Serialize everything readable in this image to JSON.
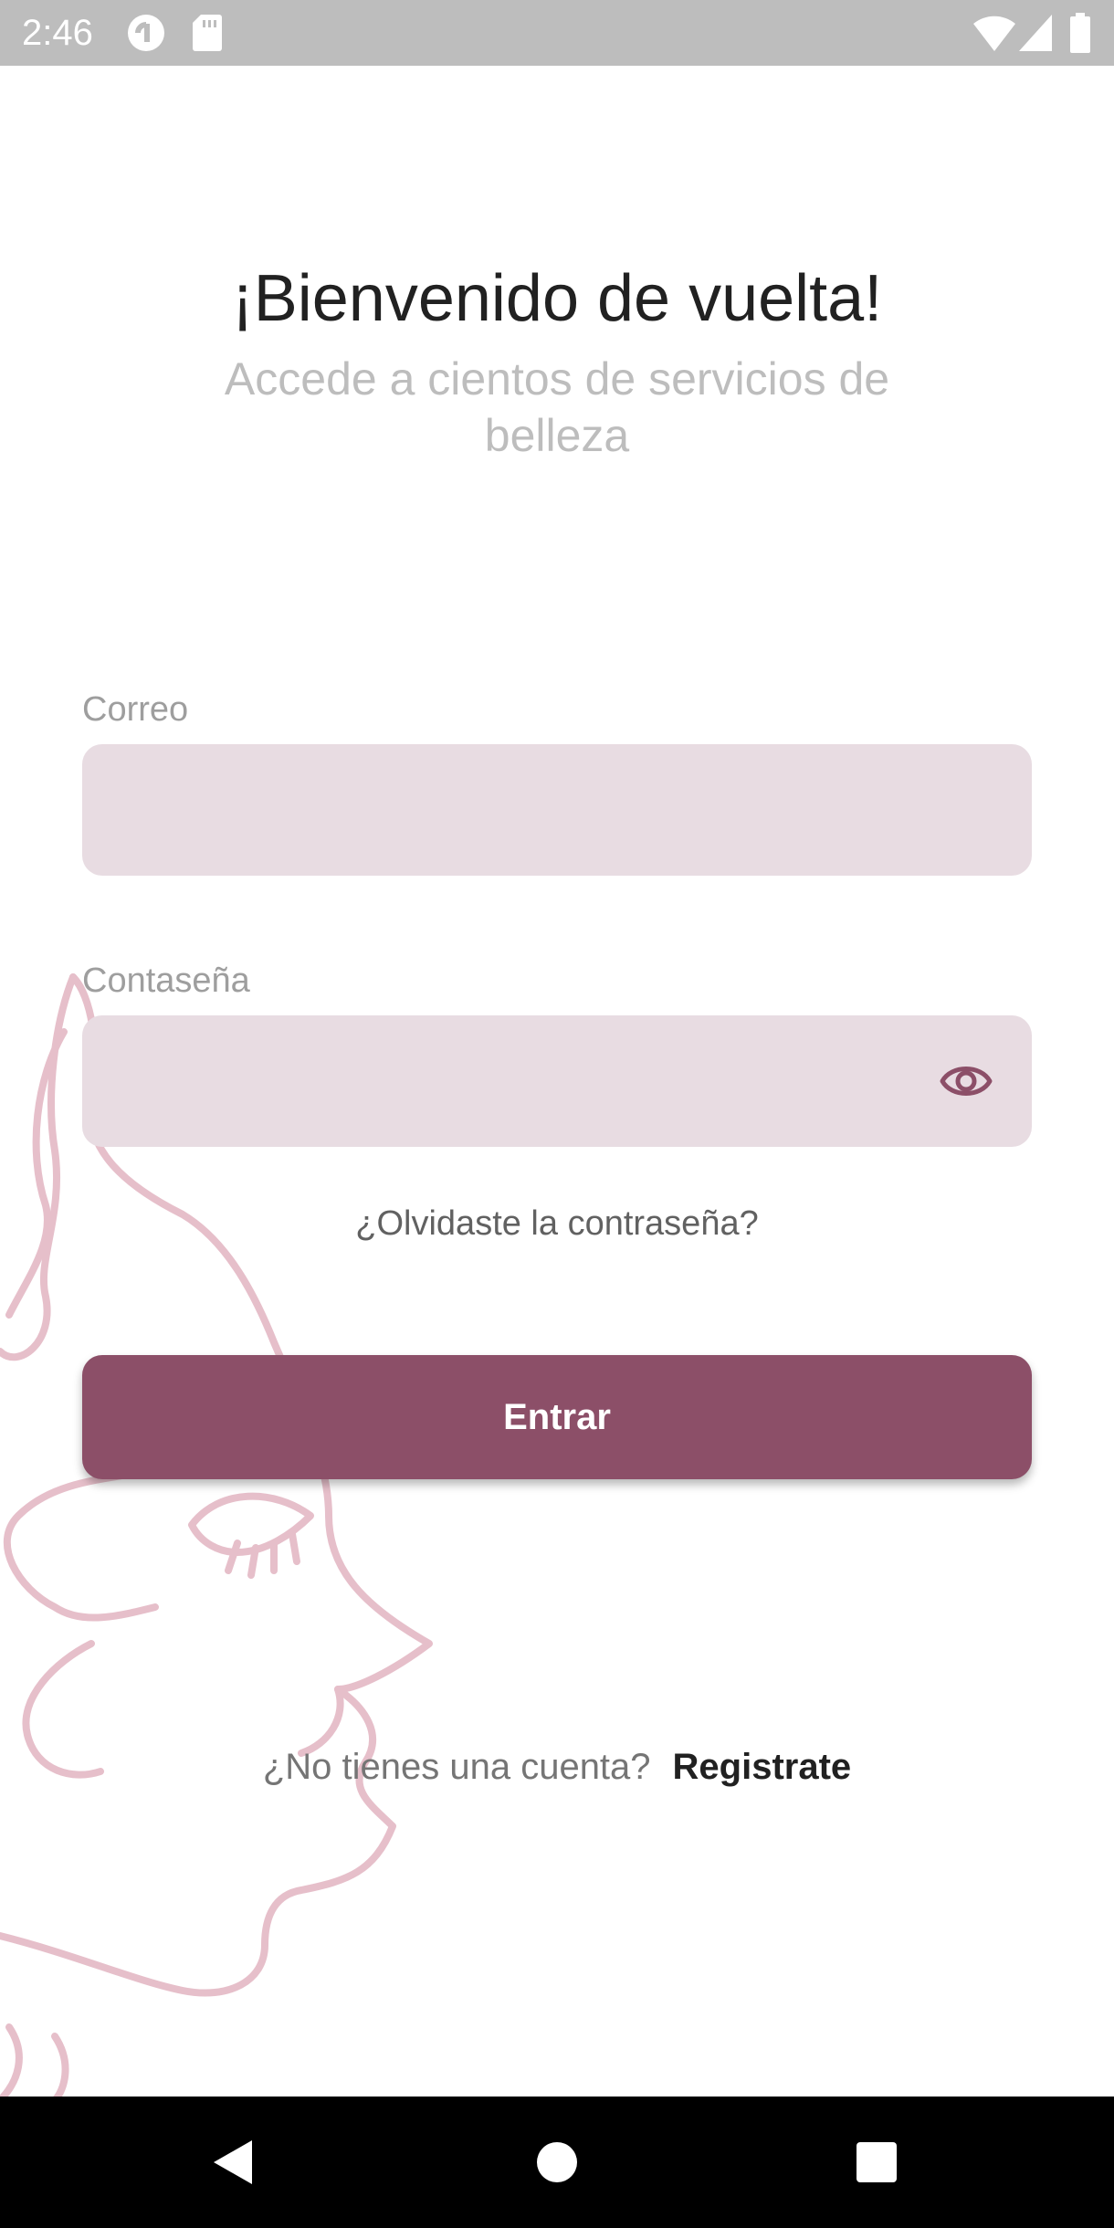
{
  "status_bar": {
    "time": "2:46",
    "icons": [
      "pocket-casts-icon",
      "sd-card-icon",
      "wifi-icon",
      "signal-icon",
      "battery-icon"
    ]
  },
  "login": {
    "title": "¡Bienvenido de vuelta!",
    "subtitle": "Accede a cientos de servicios de belleza",
    "email_label": "Correo",
    "email_value": "",
    "password_label": "Contaseña",
    "password_value": "",
    "forgot_password": "¿Olvidaste la contraseña?",
    "enter_button": "Entrar",
    "no_account_text": "¿No tienes una cuenta?",
    "register_link": "Registrate"
  },
  "colors": {
    "accent": "#8c4f68",
    "field_background": "#e8dce2",
    "line_art": "#e6bfca"
  },
  "nav_bar": {
    "buttons": [
      "back-icon",
      "home-icon",
      "recents-icon"
    ]
  }
}
